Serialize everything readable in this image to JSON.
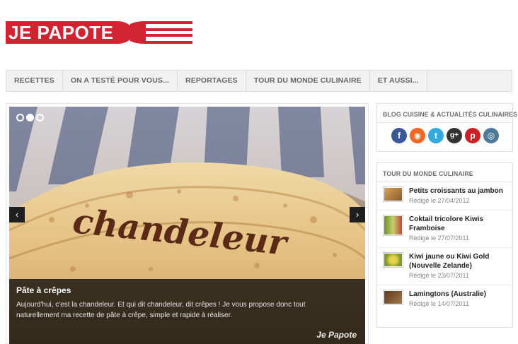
{
  "header": {
    "logo_text": "JE PAPOTE",
    "brand_color": "#d22333"
  },
  "nav": {
    "items": [
      {
        "label": "RECETTES"
      },
      {
        "label": "ON A TESTÉ POUR VOUS..."
      },
      {
        "label": "REPORTAGES"
      },
      {
        "label": "TOUR DU MONDE CULINAIRE"
      },
      {
        "label": "ET AUSSI..."
      }
    ]
  },
  "slider": {
    "dots": 3,
    "active_dot": 1,
    "prev_icon": "‹",
    "next_icon": "›",
    "caption_title": "Pâte à crêpes",
    "caption_text": "Aujourd'hui, c'est la chandeleur. Et qui dit chandeleur, dit crêpes ! Je vous propose donc tout naturellement ma recette de pâte à crêpe, simple et rapide à réaliser.",
    "watermark": "Je Papote",
    "crepe_text": "chandeleur"
  },
  "social_widget": {
    "title": "BLOG CUISINE & ACTUALITÉS CULINAIRES",
    "icons": [
      {
        "name": "facebook-icon",
        "glyph": "f",
        "color": "#3b5998"
      },
      {
        "name": "rss-icon",
        "glyph": "◉",
        "color": "#f26522"
      },
      {
        "name": "twitter-icon",
        "glyph": "t",
        "color": "#33aadd"
      },
      {
        "name": "google-plus-icon",
        "glyph": "g+",
        "color": "#333333"
      },
      {
        "name": "pinterest-icon",
        "glyph": "p",
        "color": "#cb2027"
      },
      {
        "name": "instagram-icon",
        "glyph": "◎",
        "color": "#4d7a9b"
      }
    ]
  },
  "tour_widget": {
    "title": "TOUR DU MONDE CULINAIRE",
    "items": [
      {
        "title": "Petits croissants au jambon",
        "date": "Rédigé le 27/04/2012",
        "thumb_color": "#b07a3a"
      },
      {
        "title": "Coktail tricolore Kiwis Framboise",
        "date": "Rédigé le 27/07/2011",
        "thumb_color": "#7f9a3c"
      },
      {
        "title": "Kiwi jaune ou Kiwi Gold (Nouvelle Zelande)",
        "date": "Rédigé le 23/07/2011",
        "thumb_color": "#8fae3d"
      },
      {
        "title": "Lamingtons (Australie)",
        "date": "Rédigé le 14/07/2011",
        "thumb_color": "#6b4a2f"
      }
    ]
  }
}
